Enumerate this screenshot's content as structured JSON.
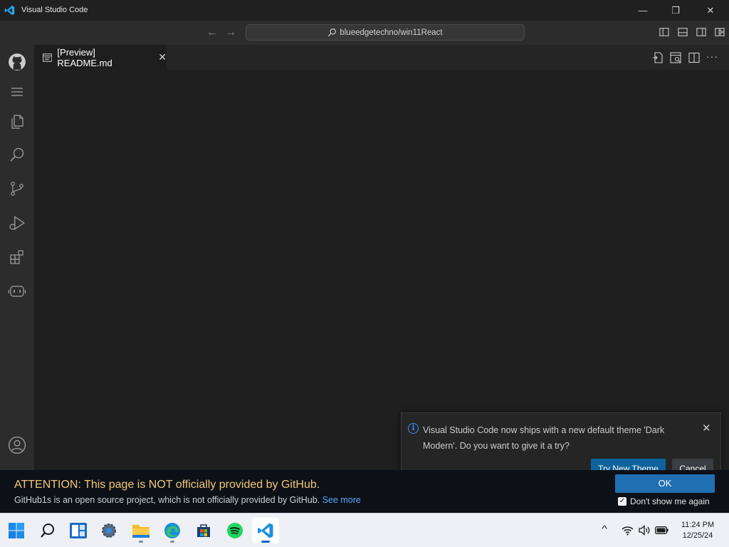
{
  "window": {
    "title": "Visual Studio Code",
    "minimize_glyph": "—",
    "restore_glyph": "❐",
    "close_glyph": "✕"
  },
  "command_center": {
    "search_text": "blueedgetechno/win11React",
    "back_glyph": "←",
    "forward_glyph": "→"
  },
  "activity_bar": {
    "items": [
      "github-icon",
      "menu-icon",
      "explorer-icon",
      "search-icon",
      "source-control-icon",
      "run-debug-icon",
      "extensions-icon",
      "copilot-icon"
    ],
    "bottom": [
      "account-icon"
    ]
  },
  "editor": {
    "tab": {
      "label": "[Preview] README.md",
      "close_glyph": "✕"
    },
    "more_glyph": "···"
  },
  "notification": {
    "message": "Visual Studio Code now ships with a new default theme 'Dark Modern'. Do you want to give it a try?",
    "info_glyph": "i",
    "close_glyph": "✕",
    "primary_button": "Try New Theme",
    "secondary_button": "Cancel"
  },
  "banner": {
    "heading": "ATTENTION: This page is NOT officially provided by GitHub.",
    "body": "GitHub1s is an open source project, which is not officially provided by GitHub.",
    "link": "See more",
    "ok_button": "OK",
    "checkbox_label": "Don't show me again",
    "checkbox_checked": true,
    "check_glyph": "✓"
  },
  "taskbar": {
    "apps": [
      "start-icon",
      "search-icon",
      "widgets-icon",
      "settings-icon",
      "file-explorer-icon",
      "edge-icon",
      "store-icon",
      "spotify-icon",
      "vscode-icon"
    ],
    "tray": {
      "chevron_glyph": "^",
      "time": "11:24 PM",
      "date": "12/25/24"
    }
  },
  "colors": {
    "accent": "#0e639c",
    "link": "#58a6ff",
    "warning_text": "#f0c674",
    "vscode_blue": "#007acc"
  }
}
